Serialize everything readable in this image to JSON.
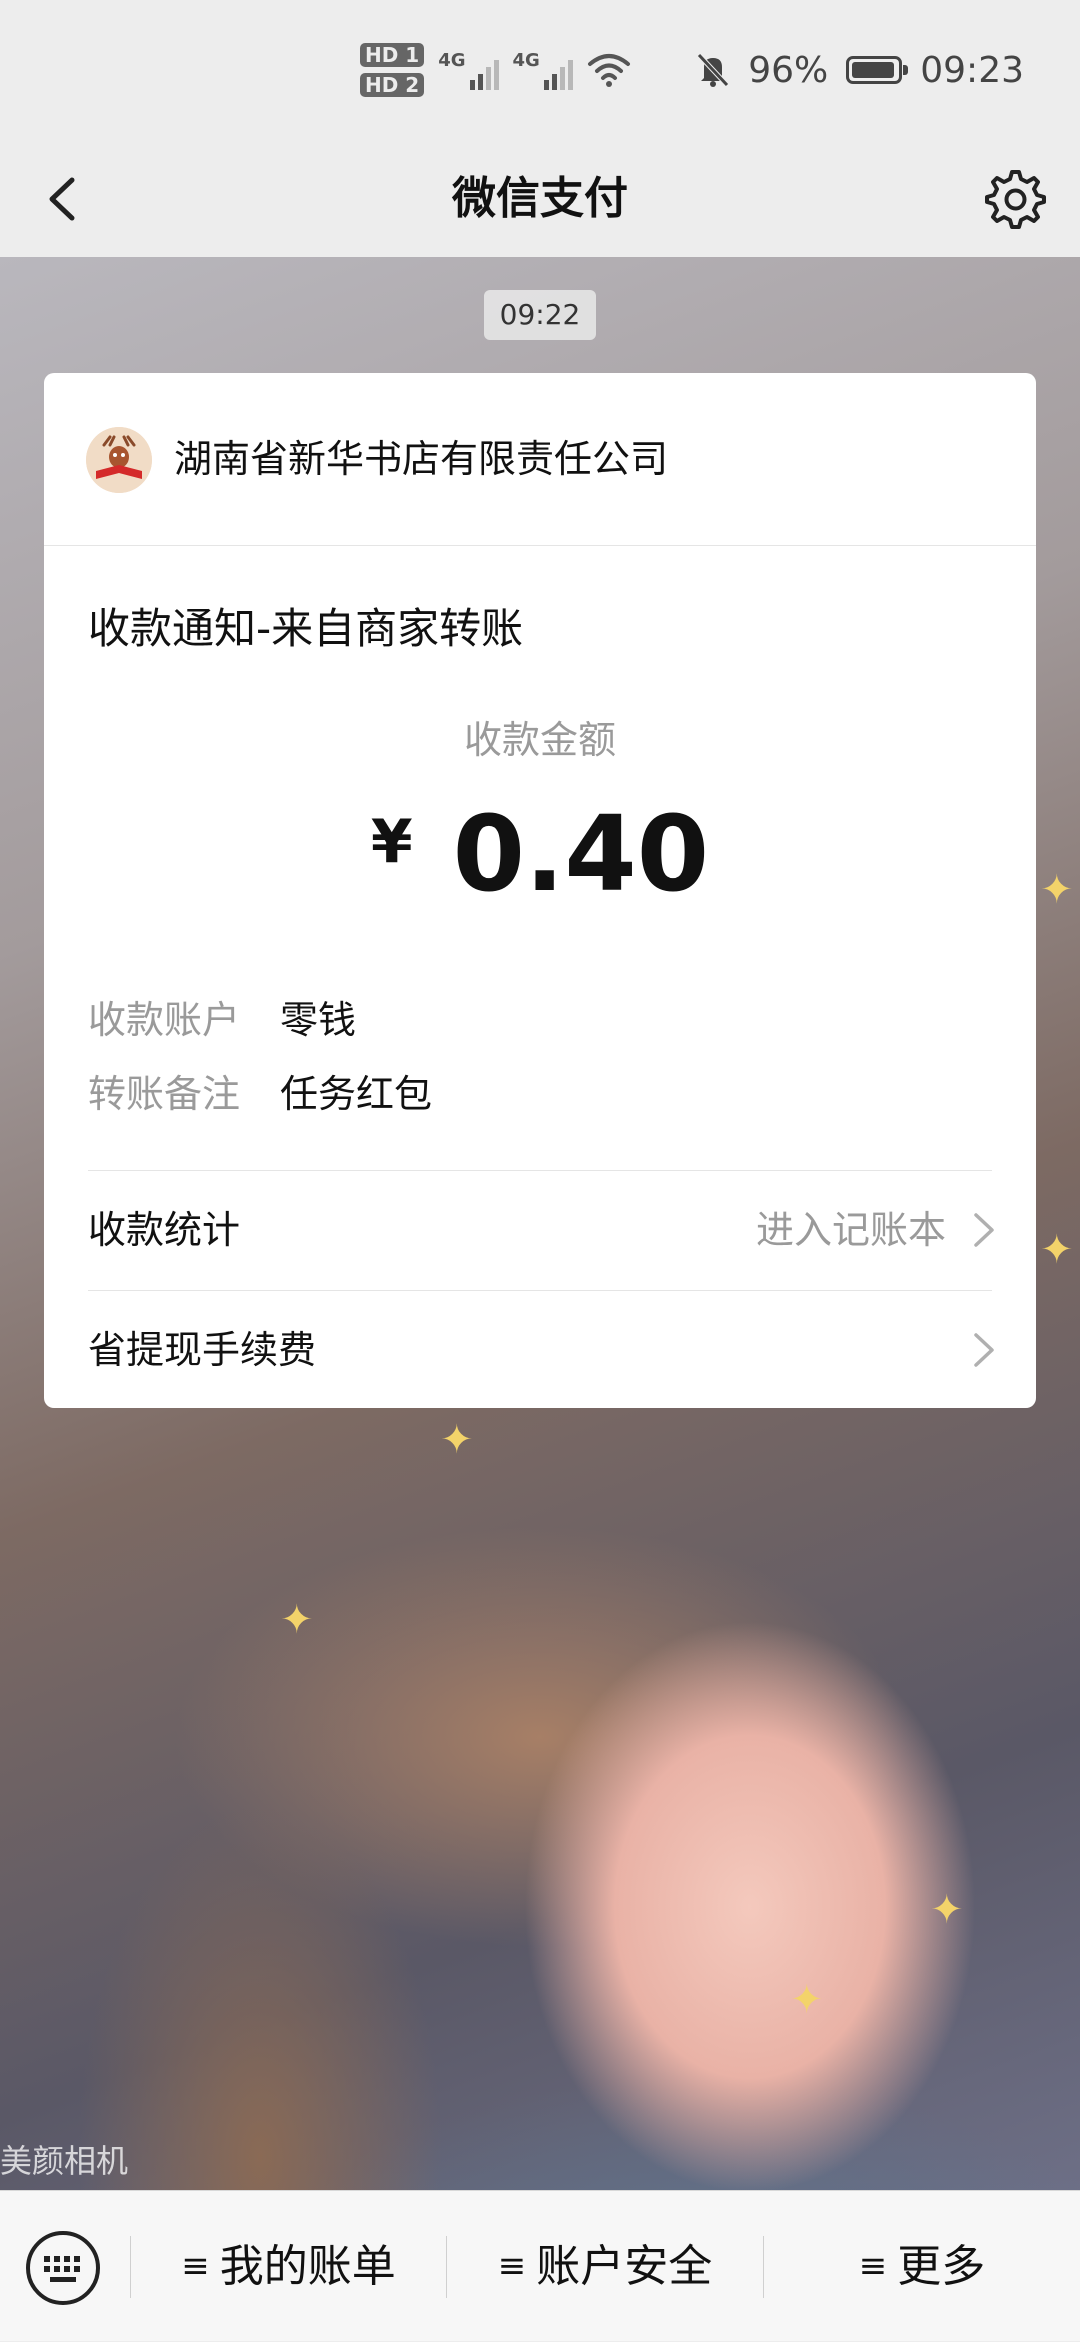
{
  "status_bar": {
    "hd1": "HD 1",
    "hd2": "HD 2",
    "net1": "4G",
    "net2": "4G",
    "battery_percent": "96%",
    "battery_level": 0.96,
    "time": "09:23"
  },
  "header": {
    "title": "微信支付",
    "back_icon": "chevron-left-icon",
    "settings_icon": "gear-icon"
  },
  "chat": {
    "timestamp": "09:22",
    "watermark": "美颜相机"
  },
  "card": {
    "merchant_name": "湖南省新华书店有限责任公司",
    "notice_title": "收款通知-来自商家转账",
    "amount_label": "收款金额",
    "currency": "¥",
    "amount": "0.40",
    "details": [
      {
        "key": "收款账户",
        "value": "零钱"
      },
      {
        "key": "转账备注",
        "value": "任务红包"
      }
    ],
    "links": [
      {
        "label": "收款统计",
        "hint": "进入记账本"
      },
      {
        "label": "省提现手续费",
        "hint": ""
      }
    ]
  },
  "bottom_menu": {
    "keyboard_icon": "keyboard-icon",
    "items": [
      {
        "lines": "≡",
        "label": "我的账单"
      },
      {
        "lines": "≡",
        "label": "账户安全"
      },
      {
        "lines": "≡",
        "label": "更多"
      }
    ]
  },
  "colors": {
    "background": "#ededed",
    "card": "#ffffff",
    "secondary_text": "#9a9a9a"
  }
}
